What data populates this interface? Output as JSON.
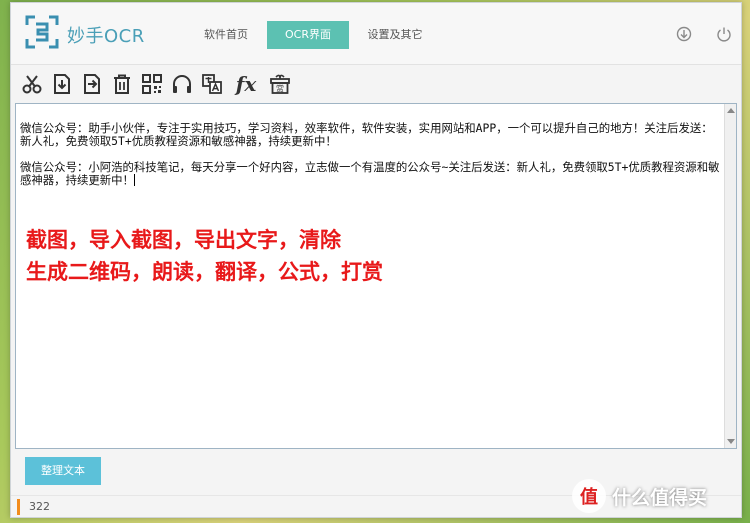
{
  "window": {
    "app_title": "妙手OCR",
    "tabs": [
      {
        "label": "软件首页",
        "active": false
      },
      {
        "label": "OCR界面",
        "active": true
      },
      {
        "label": "设置及其它",
        "active": false
      }
    ]
  },
  "toolbar": {
    "tools": [
      {
        "icon": "scissors-icon"
      },
      {
        "icon": "import-icon"
      },
      {
        "icon": "export-icon"
      },
      {
        "icon": "trash-icon"
      },
      {
        "icon": "qrcode-icon"
      },
      {
        "icon": "headphones-icon"
      },
      {
        "icon": "translate-icon"
      },
      {
        "icon": "formula-icon",
        "label": "fx"
      },
      {
        "icon": "gift-icon",
        "label": "赏"
      }
    ]
  },
  "editor": {
    "paragraphs": [
      "微信公众号：助手小伙伴，专注于实用技巧，学习资料，效率软件，软件安装，实用网站和APP，一个可以提升自己的地方！关注后发送：新人礼，免费领取5T+优质教程资源和敏感神器，持续更新中！",
      "微信公众号：小阿浩的科技笔记，每天分享一个好内容，立志做一个有温度的公众号~关注后发送：新人礼，免费领取5T+优质教程资源和敏感神器，持续更新中！"
    ],
    "overlay_lines": [
      "截图，导入截图，导出文字，清除",
      "生成二维码，朗读，翻译，公式，打赏"
    ]
  },
  "actions": {
    "tidy_label": "整理文本"
  },
  "status": {
    "count": "322"
  },
  "watermark": {
    "badge": "值",
    "text": "什么值得买"
  },
  "colors": {
    "accent": "#5cc1b2",
    "button": "#5cc1d9",
    "overlay_text": "#e8191a",
    "status_accent": "#f28c1c"
  }
}
